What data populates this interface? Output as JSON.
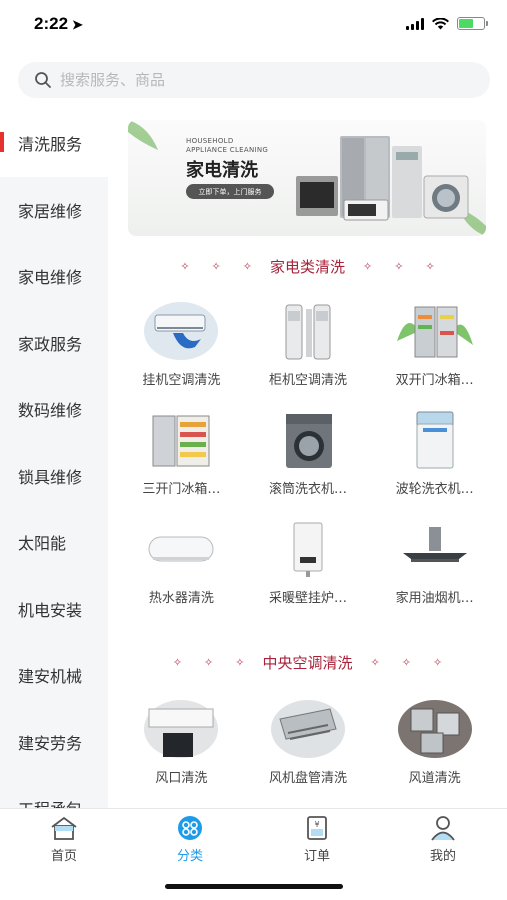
{
  "status": {
    "time": "2:22",
    "battery_color": "#4cd964"
  },
  "search": {
    "placeholder": "搜索服务、商品"
  },
  "sidebar": {
    "items": [
      {
        "label": "清洗服务",
        "active": true
      },
      {
        "label": "家居维修"
      },
      {
        "label": "家电维修"
      },
      {
        "label": "家政服务"
      },
      {
        "label": "数码维修"
      },
      {
        "label": "锁具维修"
      },
      {
        "label": "太阳能"
      },
      {
        "label": "机电安装"
      },
      {
        "label": "建安机械"
      },
      {
        "label": "建安劳务"
      },
      {
        "label": "工程承包"
      }
    ]
  },
  "banner": {
    "en_line1": "HOUSEHOLD",
    "en_line2": "APPLIANCE CLEANING",
    "title": "家电清洗",
    "button": "立即下单，上门服务"
  },
  "sections": [
    {
      "title": "家电类清洗",
      "items": [
        {
          "name": "挂机空调清洗",
          "icon": "wall-ac-icon"
        },
        {
          "name": "柜机空调清洗",
          "icon": "floor-ac-icon"
        },
        {
          "name": "双开门冰箱…",
          "icon": "double-door-fridge-icon"
        },
        {
          "name": "三开门冰箱…",
          "icon": "triple-door-fridge-icon"
        },
        {
          "name": "滚筒洗衣机…",
          "icon": "drum-washer-icon"
        },
        {
          "name": "波轮洗衣机…",
          "icon": "top-load-washer-icon"
        },
        {
          "name": "热水器清洗",
          "icon": "water-heater-icon"
        },
        {
          "name": "采暖壁挂炉…",
          "icon": "wall-boiler-icon"
        },
        {
          "name": "家用油烟机…",
          "icon": "range-hood-icon"
        }
      ]
    },
    {
      "title": "中央空调清洗",
      "items": [
        {
          "name": "风口清洗",
          "icon": "air-vent-icon"
        },
        {
          "name": "风机盘管清洗",
          "icon": "fan-coil-icon"
        },
        {
          "name": "风道清洗",
          "icon": "air-duct-icon"
        }
      ]
    }
  ],
  "tabbar": {
    "tabs": [
      {
        "label": "首页",
        "icon": "home-icon"
      },
      {
        "label": "分类",
        "icon": "category-icon",
        "active": true
      },
      {
        "label": "订单",
        "icon": "order-icon"
      },
      {
        "label": "我的",
        "icon": "profile-icon"
      }
    ],
    "active_color": "#1e9be8"
  },
  "colors": {
    "accent_red": "#e5322d",
    "section_title": "#a8233a"
  }
}
